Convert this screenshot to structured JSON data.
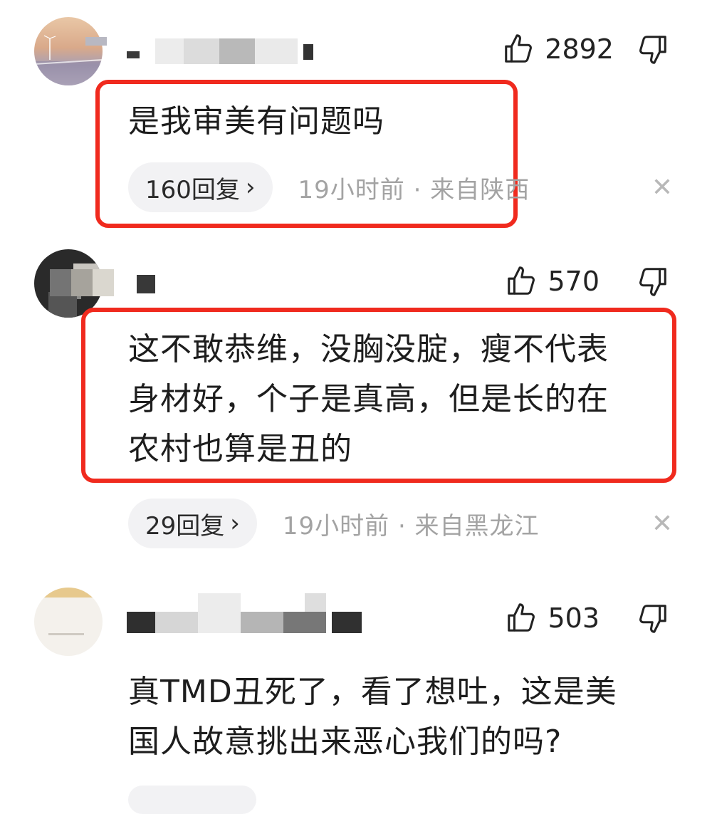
{
  "comments": [
    {
      "likes": "2892",
      "text": "是我审美有问题吗",
      "replies": "160回复",
      "meta": "19小时前 · 来自陕西"
    },
    {
      "likes": "570",
      "text_lines": [
        "这不敢恭维，没胸没腚，瘦不代表",
        "身材好，个子是真高，但是长的在",
        "农村也算是丑的"
      ],
      "replies": "29回复",
      "meta": "19小时前 · 来自黑龙江"
    },
    {
      "likes": "503",
      "text_lines": [
        "真TMD丑死了，看了想吐，这是美",
        "国人故意挑出来恶心我们的吗?"
      ]
    }
  ],
  "icons": [
    "thumbs-up-icon",
    "thumbs-down-icon",
    "chevron-right-icon",
    "close-icon"
  ],
  "colors": {
    "highlight": "#f02a1e",
    "meta": "#a3a3a3",
    "pill_bg": "#f2f2f4"
  }
}
